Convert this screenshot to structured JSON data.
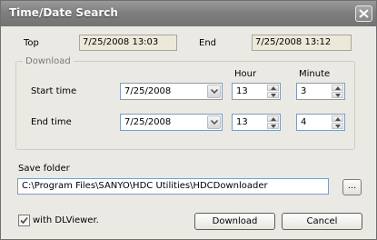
{
  "window": {
    "title": "Time/Date Search"
  },
  "range": {
    "top_label": "Top",
    "top_value": "7/25/2008 13:03",
    "end_label": "End",
    "end_value": "7/25/2008 13:12"
  },
  "download_group": {
    "legend": "Download",
    "hour_header": "Hour",
    "minute_header": "Minute",
    "start": {
      "label": "Start time",
      "date": "7/25/2008",
      "hour": "13",
      "minute": "3"
    },
    "end": {
      "label": "End time",
      "date": "7/25/2008",
      "hour": "13",
      "minute": "4"
    }
  },
  "save": {
    "label": "Save folder",
    "path": "C:\\Program Files\\SANYO\\HDC Utilities\\HDCDownloader",
    "browse_label": "..."
  },
  "options": {
    "with_dlviewer_label": "with DLViewer.",
    "with_dlviewer_checked": true
  },
  "buttons": {
    "download": "Download",
    "cancel": "Cancel"
  },
  "icons": {
    "close": "close-icon",
    "dropdown": "chevron-down-icon",
    "spin_up": "spin-up-icon",
    "spin_down": "spin-down-icon",
    "check": "check-icon"
  }
}
